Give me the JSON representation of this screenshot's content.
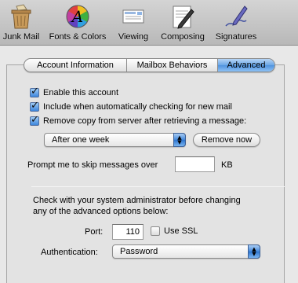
{
  "toolbar": {
    "items": [
      {
        "label": "Junk Mail",
        "icon": "junk-mail-icon"
      },
      {
        "label": "Fonts & Colors",
        "icon": "fonts-colors-icon"
      },
      {
        "label": "Viewing",
        "icon": "viewing-icon"
      },
      {
        "label": "Composing",
        "icon": "composing-icon"
      },
      {
        "label": "Signatures",
        "icon": "signatures-icon"
      }
    ]
  },
  "tabs": [
    {
      "label": "Account Information",
      "active": false
    },
    {
      "label": "Mailbox Behaviors",
      "active": false
    },
    {
      "label": "Advanced",
      "active": true
    }
  ],
  "options": {
    "enable_account": {
      "label": "Enable this account",
      "checked": true
    },
    "include_checking": {
      "label": "Include when automatically checking for new mail",
      "checked": true
    },
    "remove_copy": {
      "label": "Remove copy from server after retrieving a message:",
      "checked": true
    }
  },
  "remove_after": {
    "selected": "After one week"
  },
  "remove_now_label": "Remove now",
  "prompt_skip": {
    "label": "Prompt me to skip messages over",
    "value": "",
    "unit": "KB"
  },
  "admin_note_line1": "Check with your system administrator before changing",
  "admin_note_line2": "any of the advanced options below:",
  "port": {
    "label": "Port:",
    "value": "110"
  },
  "use_ssl": {
    "label": "Use SSL",
    "checked": false
  },
  "authentication": {
    "label": "Authentication:",
    "selected": "Password"
  },
  "colors": {
    "accent_blue": "#4f92de",
    "window_bg": "#e8e8e8"
  }
}
